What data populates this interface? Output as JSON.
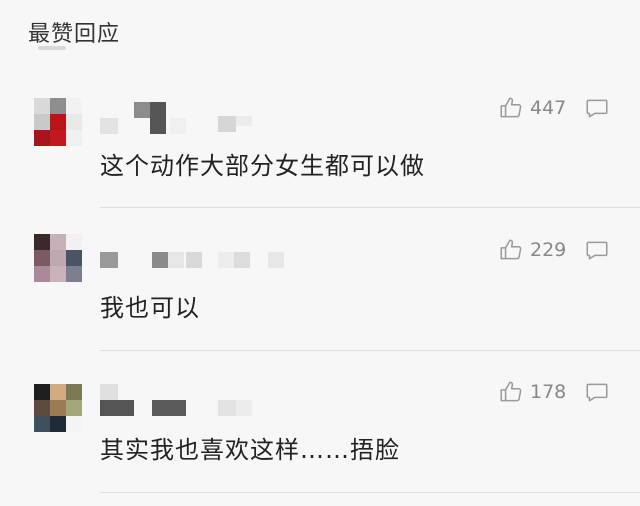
{
  "header": {
    "title": "最赞回应"
  },
  "comments": [
    {
      "avatar_colors": [
        "#d9d9d9",
        "#8e8e8e",
        "#f2f2f2",
        "#c9c9c9",
        "#b91418",
        "#e9e9e9",
        "#a6151a",
        "#c1191f",
        "#f0f0f0"
      ],
      "likes": "447",
      "text": "这个动作大部分女生都可以做"
    },
    {
      "avatar_colors": [
        "#3a2a2a",
        "#c7b0b8",
        "#f1f1f1",
        "#7d5a63",
        "#c0a8b0",
        "#4b5366",
        "#a9899a",
        "#c9b2bb",
        "#7c7f8f"
      ],
      "likes": "229",
      "text": "我也可以"
    },
    {
      "avatar_colors": [
        "#1f1f1f",
        "#d2ab80",
        "#7c7a55",
        "#5b4a3d",
        "#9b7c52",
        "#a6a67d",
        "#3e4f5e",
        "#1e2b37",
        "#f4f4f4"
      ],
      "likes": "178",
      "text": "其实我也喜欢这样……捂脸"
    }
  ],
  "icons": {
    "like": "thumbs-up-icon",
    "reply": "comment-bubble-icon"
  }
}
